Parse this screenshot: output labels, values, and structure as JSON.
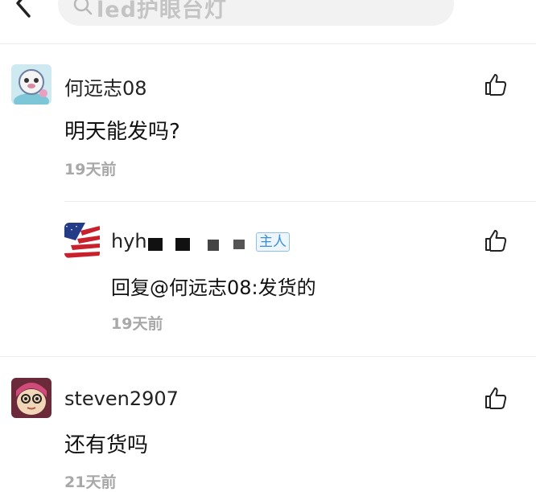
{
  "header": {
    "search_text": "led护眼台灯",
    "back_icon": "chevron-left-icon",
    "more_icon": "more-horizontal-icon"
  },
  "comments": [
    {
      "user": "何远志08",
      "text": "明天能发吗?",
      "time": "19天前",
      "reply": {
        "user_prefix": "hyh",
        "badge": "主人",
        "text": "回复@何远志08:发货的",
        "time": "19天前"
      }
    },
    {
      "user": "steven2907",
      "text": "还有货吗",
      "time": "21天前"
    }
  ],
  "colors": {
    "badge": "#3a8fd6",
    "time": "#a8a8a8",
    "search_bg": "#f2f2f2"
  }
}
